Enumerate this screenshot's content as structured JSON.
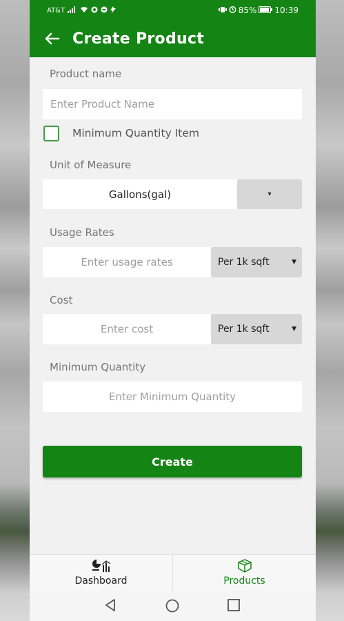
{
  "status_bar": {
    "carrier": "AT&T",
    "battery": "85%",
    "time": "10:39"
  },
  "app_bar": {
    "title": "Create Product"
  },
  "form": {
    "product_name_label": "Product name",
    "product_name_placeholder": "Enter Product Name",
    "min_qty_item_label": "Minimum Quantity Item",
    "min_qty_item_checked": false,
    "uom_label": "Unit of Measure",
    "uom_value": "Gallons(gal)",
    "uom_caret": "▾",
    "usage_label": "Usage Rates",
    "usage_placeholder": "Enter usage rates",
    "usage_unit": "Per 1k sqft",
    "cost_label": "Cost",
    "cost_placeholder": "Enter cost",
    "cost_unit": "Per 1k sqft",
    "min_qty_label": "Minimum Quantity",
    "min_qty_placeholder": "Enter Minimum Quantity",
    "submit_label": "Create"
  },
  "bottom_nav": {
    "items": [
      {
        "label": "Dashboard",
        "icon": "dashboard-icon",
        "active": false
      },
      {
        "label": "Products",
        "icon": "box-icon",
        "active": true
      }
    ]
  },
  "colors": {
    "primary": "#148414",
    "active_nav": "#148414",
    "inactive_nav": "#222222"
  }
}
